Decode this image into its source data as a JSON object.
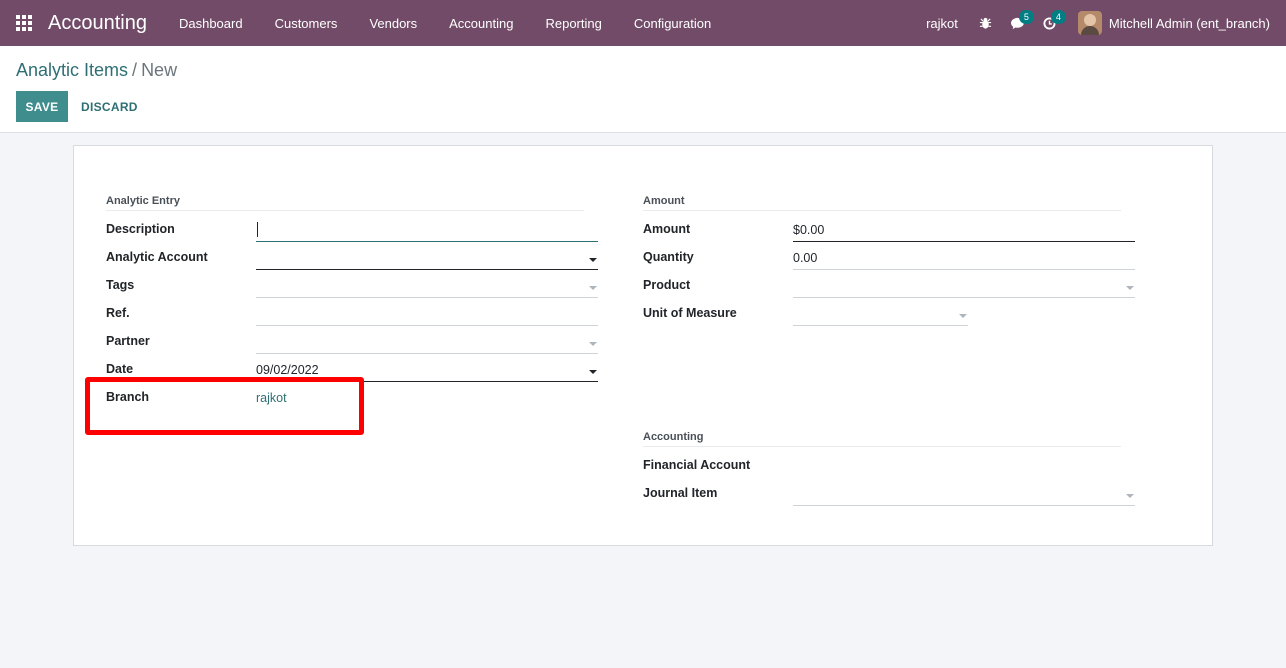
{
  "navbar": {
    "app_title": "Accounting",
    "menu": [
      "Dashboard",
      "Customers",
      "Vendors",
      "Accounting",
      "Reporting",
      "Configuration"
    ],
    "company": "rajkot",
    "messages_count": "5",
    "activities_count": "4",
    "user": "Mitchell Admin (ent_branch)",
    "bg_color": "#714b67"
  },
  "breadcrumb": {
    "parent": "Analytic Items",
    "separator": "/",
    "current": "New"
  },
  "buttons": {
    "save": "SAVE",
    "discard": "DISCARD"
  },
  "left_group": {
    "title": "Analytic Entry",
    "fields": {
      "description": {
        "label": "Description",
        "value": ""
      },
      "analytic_account": {
        "label": "Analytic Account",
        "value": ""
      },
      "tags": {
        "label": "Tags",
        "value": ""
      },
      "ref": {
        "label": "Ref.",
        "value": ""
      },
      "partner": {
        "label": "Partner",
        "value": ""
      },
      "date": {
        "label": "Date",
        "value": "09/02/2022"
      },
      "branch": {
        "label": "Branch",
        "value": "rajkot"
      }
    }
  },
  "amount_group": {
    "title": "Amount",
    "fields": {
      "amount": {
        "label": "Amount",
        "value": "$0.00"
      },
      "quantity": {
        "label": "Quantity",
        "value": "0.00"
      },
      "product": {
        "label": "Product",
        "value": ""
      },
      "uom": {
        "label": "Unit of Measure",
        "value": ""
      }
    }
  },
  "accounting_group": {
    "title": "Accounting",
    "fields": {
      "financial_account": {
        "label": "Financial Account",
        "value": ""
      },
      "journal_item": {
        "label": "Journal Item",
        "value": ""
      }
    }
  },
  "annotation": {
    "color": "#ff0000"
  }
}
